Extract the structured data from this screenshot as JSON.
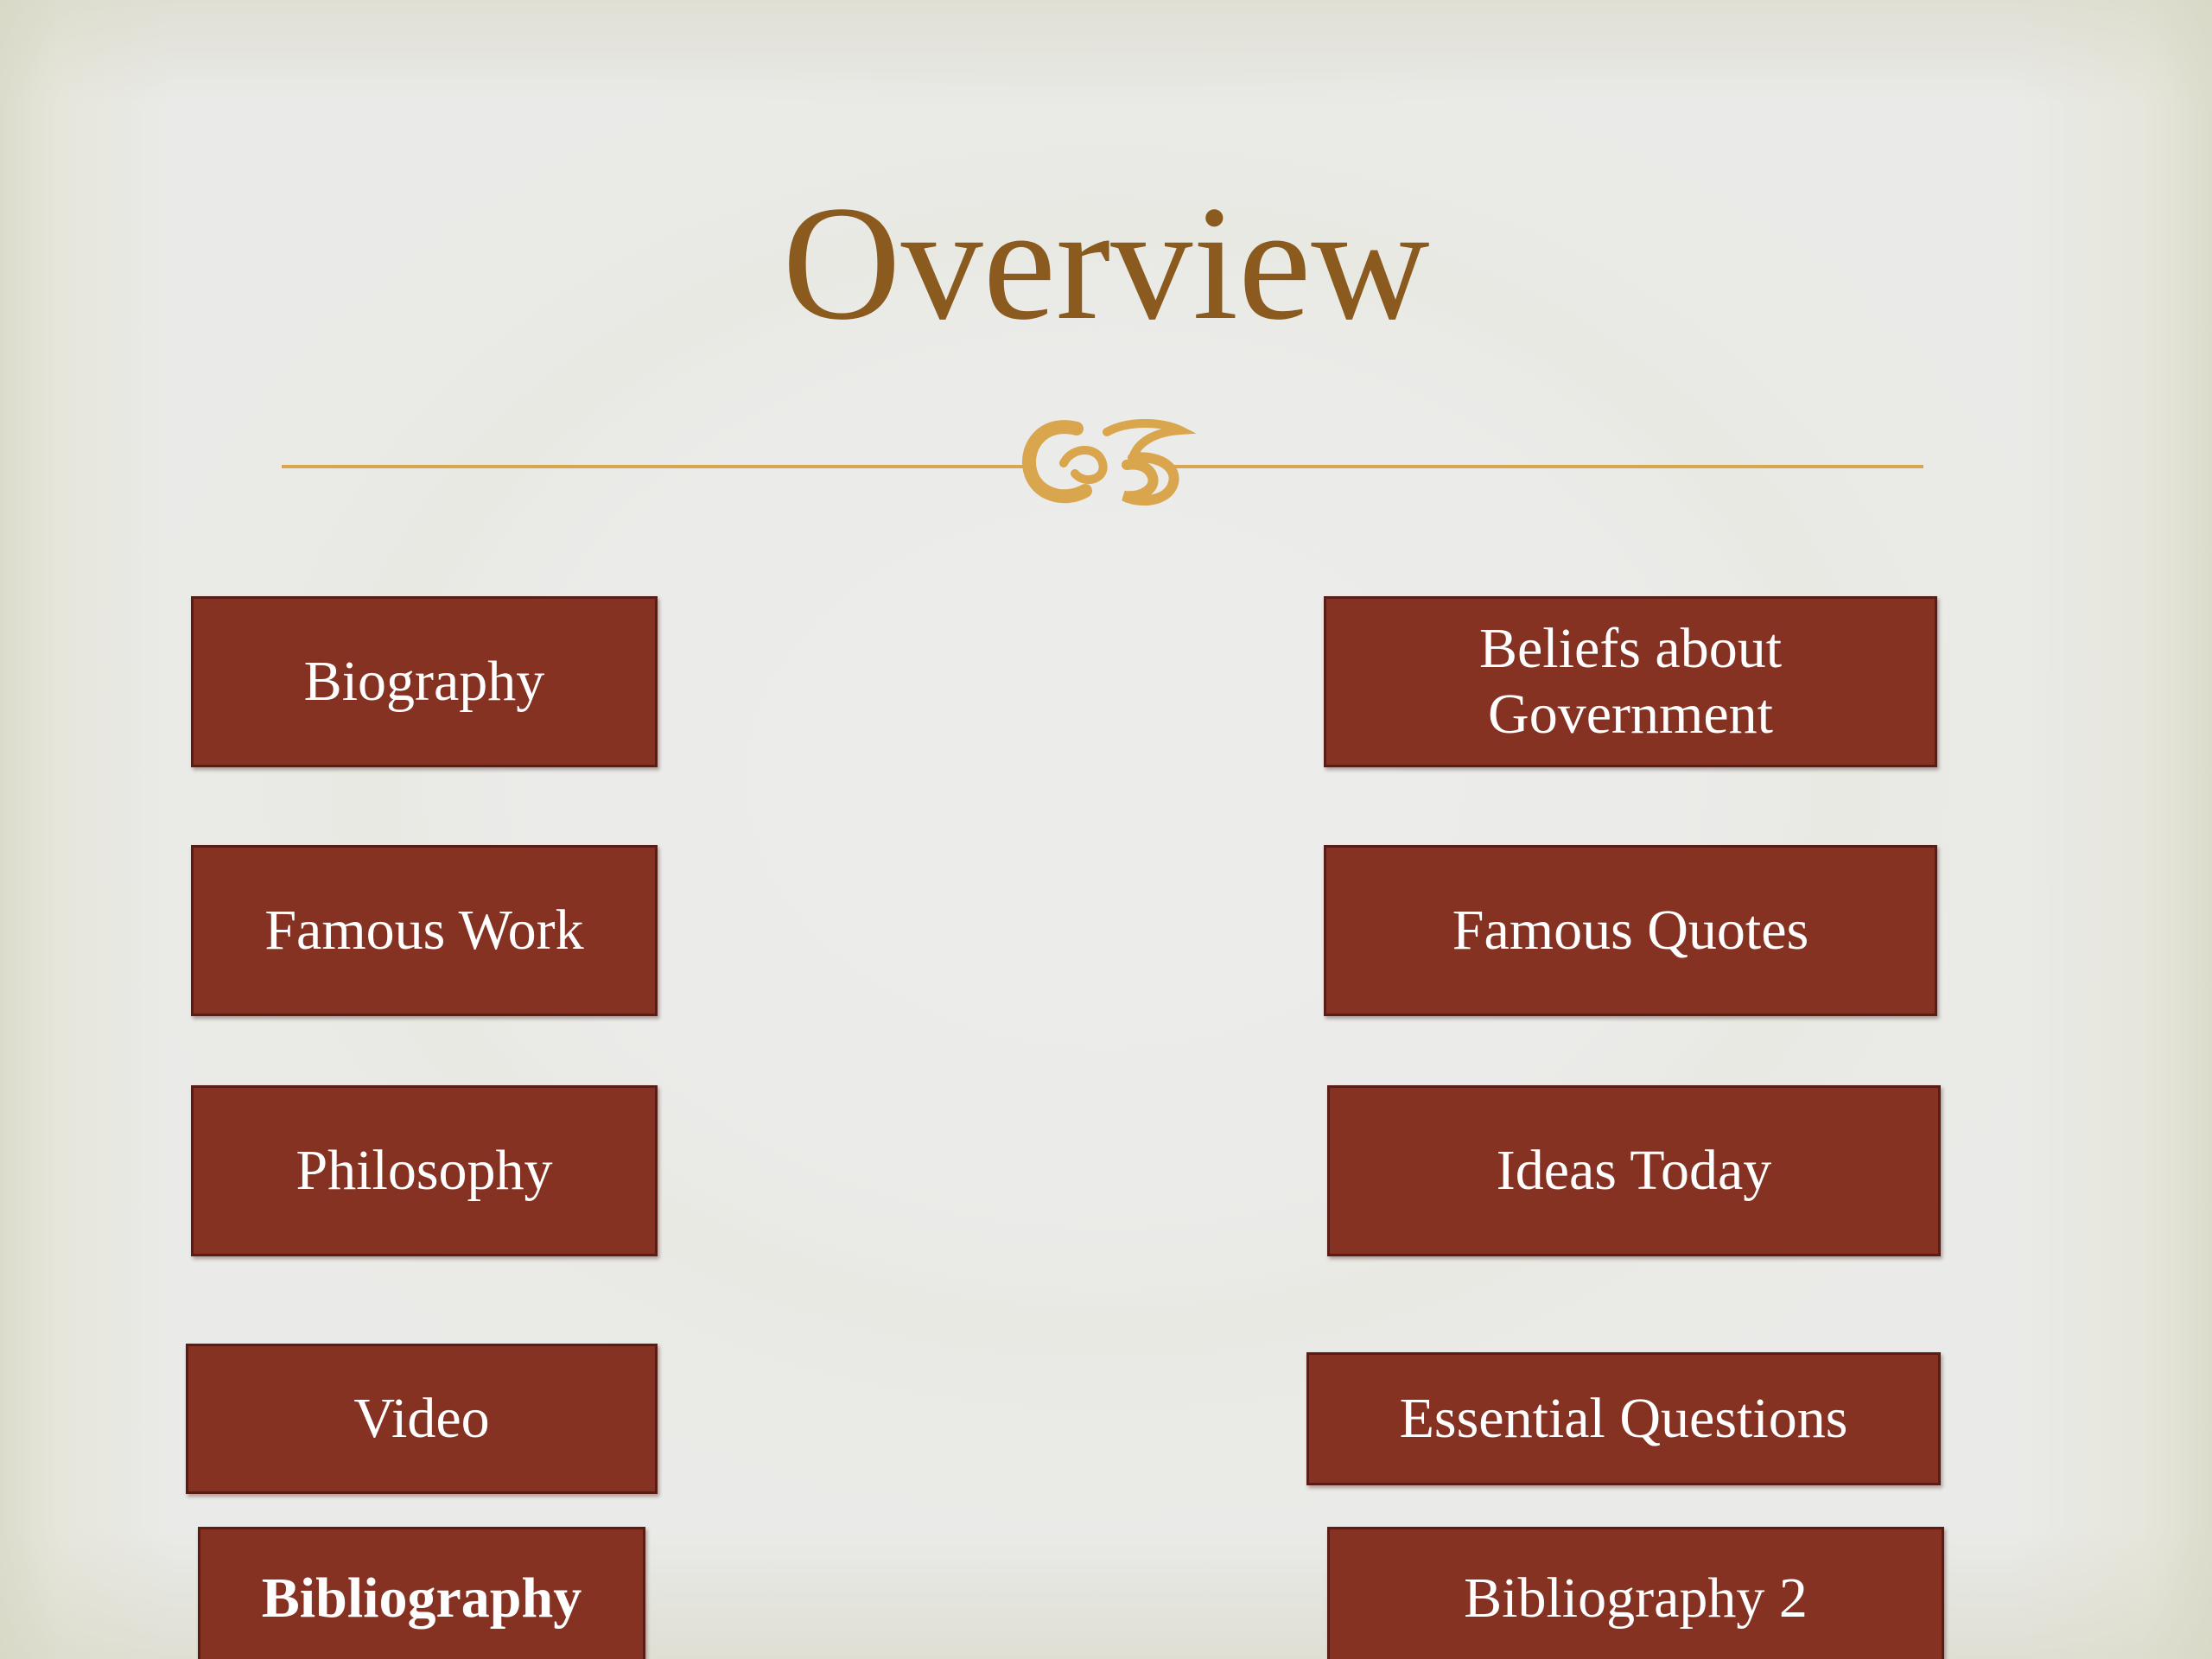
{
  "slide": {
    "title": "Overview",
    "ornament_icon": "flourish-ornament-icon",
    "colors": {
      "title": "#8a5a1e",
      "ornament": "#d9a54d",
      "button_fill": "#853223",
      "button_border": "#5a1c14",
      "button_text": "#ffffff",
      "background": "#eaeae8"
    },
    "left_buttons": [
      {
        "label": "Biography"
      },
      {
        "label": "Famous Work"
      },
      {
        "label": "Philosophy"
      },
      {
        "label": "Video"
      },
      {
        "label": "Bibliography"
      }
    ],
    "right_buttons": [
      {
        "label_line1": "Beliefs about",
        "label_line2": "Government"
      },
      {
        "label": "Famous Quotes"
      },
      {
        "label": "Ideas Today"
      },
      {
        "label": "Essential Questions"
      },
      {
        "label": "Bibliography 2"
      }
    ]
  }
}
